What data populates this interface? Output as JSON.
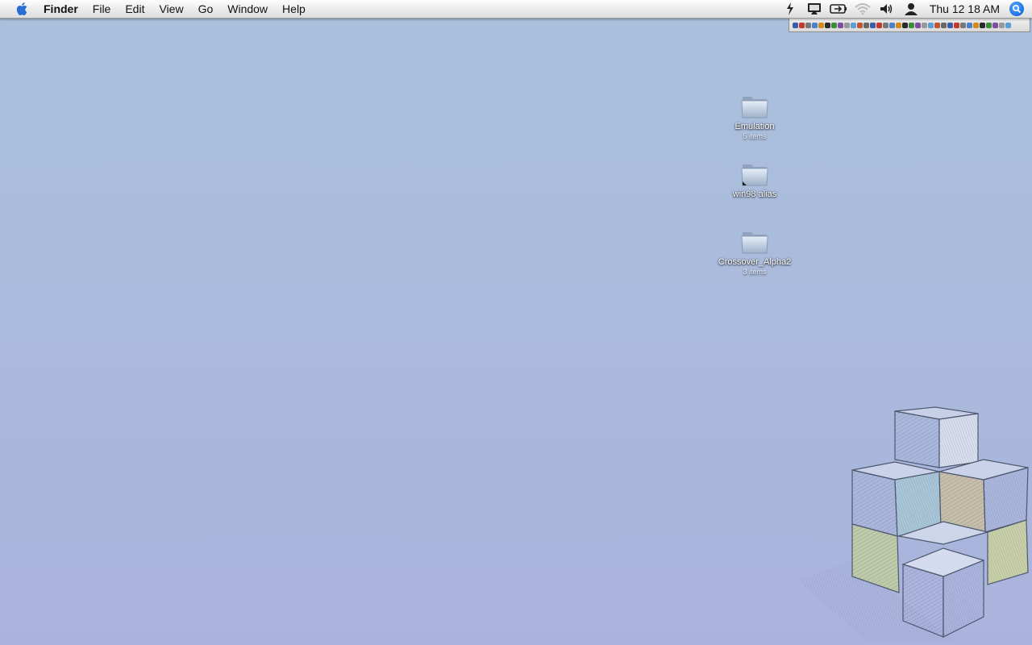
{
  "menubar": {
    "app_name": "Finder",
    "items": [
      "File",
      "Edit",
      "View",
      "Go",
      "Window",
      "Help"
    ],
    "clock": "Thu 12 18 AM",
    "status_icons": [
      "script-icon",
      "display-icon",
      "battery-icon",
      "wifi-icon",
      "volume-icon",
      "user-icon"
    ]
  },
  "desktop": {
    "icons": [
      {
        "name": "Emulation",
        "sub": "5 items",
        "kind": "folder"
      },
      {
        "name": "win98 alias",
        "sub": "",
        "kind": "alias"
      },
      {
        "name": "Crossover_Alpha2",
        "sub": "3 items",
        "kind": "folder"
      }
    ]
  },
  "colors": {
    "desktop_top": "#a9c1dc",
    "desktop_bottom": "#aab3dd",
    "spotlight": "#1c6fe0"
  }
}
